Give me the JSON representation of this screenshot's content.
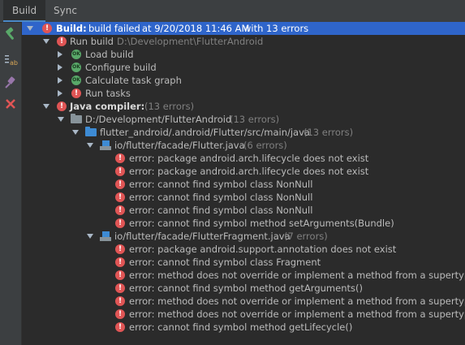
{
  "tabs": [
    {
      "label": "Build",
      "active": true
    },
    {
      "label": "Sync",
      "active": false
    }
  ],
  "toolbar": {
    "icons": [
      "hammer-icon",
      "filter-icon",
      "pin-icon",
      "close-icon"
    ],
    "colors": {
      "hammer": "#59a869",
      "close": "#e05555"
    }
  },
  "tree": {
    "root": {
      "label": "Build:",
      "status": "build failed",
      "time": "at 9/20/2018 11:46 AM",
      "summary": "with 13 errors"
    },
    "run_build": {
      "label": "Run build",
      "path": "D:\\Development\\FlutterAndroid"
    },
    "tasks": [
      {
        "label": "Load build",
        "status": "ok"
      },
      {
        "label": "Configure build",
        "status": "ok"
      },
      {
        "label": "Calculate task graph",
        "status": "ok"
      },
      {
        "label": "Run tasks",
        "status": "error"
      }
    ],
    "java_compiler": {
      "label": "Java compiler:",
      "count": "(13 errors)"
    },
    "project": {
      "label": "D:/Development/FlutterAndroid",
      "count": "(13 errors)"
    },
    "src": {
      "label": "flutter_android/.android/Flutter/src/main/java",
      "count": "(13 errors)"
    },
    "files": [
      {
        "label": "io/flutter/facade/Flutter.java",
        "count": "(6 errors)",
        "errors": [
          "error: package android.arch.lifecycle does not exist",
          "error: package android.arch.lifecycle does not exist",
          "error: cannot find symbol class NonNull",
          "error: cannot find symbol class NonNull",
          "error: cannot find symbol class NonNull",
          "error: cannot find symbol method setArguments(Bundle)"
        ]
      },
      {
        "label": "io/flutter/facade/FlutterFragment.java",
        "count": "(7 errors)",
        "errors": [
          "error: package android.support.annotation does not exist",
          "error: cannot find symbol class Fragment",
          "error: method does not override or implement a method from a supertype",
          "error: cannot find symbol method getArguments()",
          "error: method does not override or implement a method from a supertype",
          "error: method does not override or implement a method from a supertype",
          "error: cannot find symbol method getLifecycle()"
        ]
      }
    ]
  }
}
